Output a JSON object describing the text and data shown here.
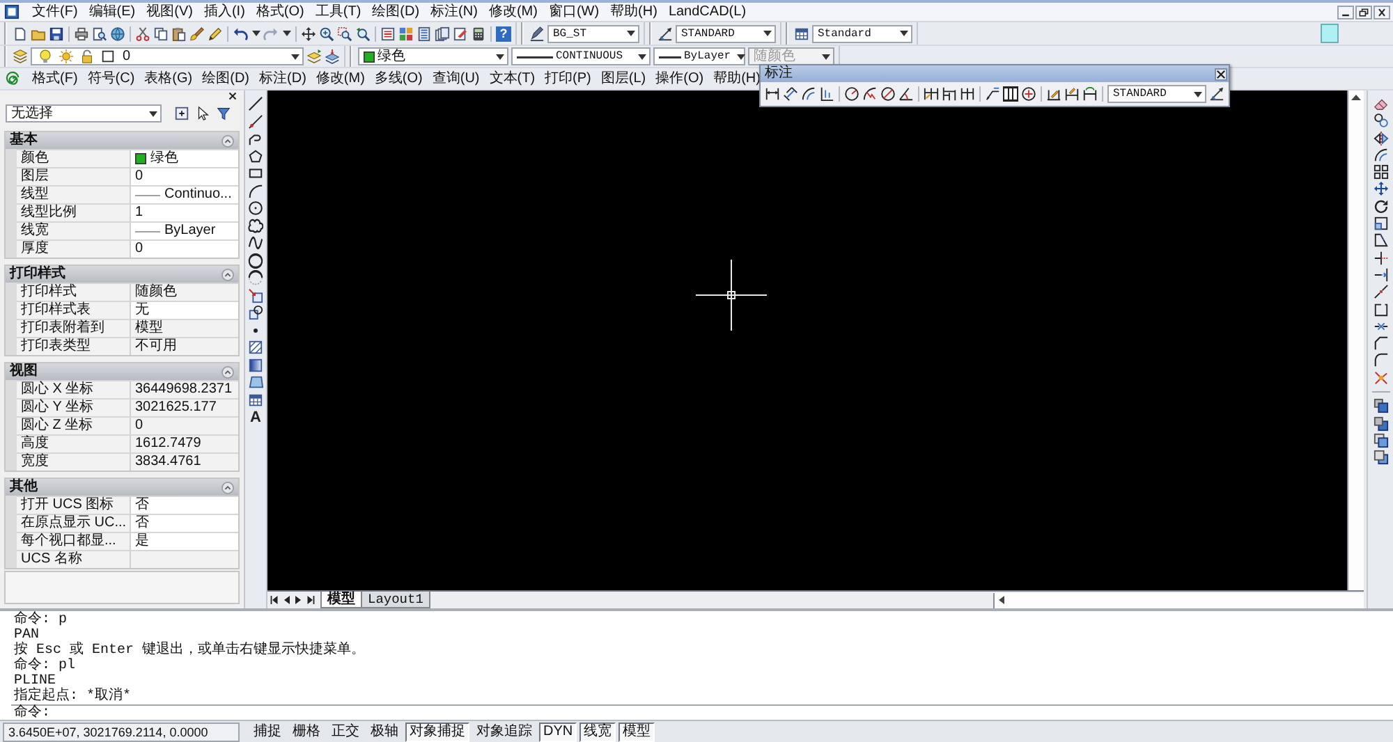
{
  "menu_bar": {
    "items": [
      "文件(F)",
      "编辑(E)",
      "视图(V)",
      "插入(I)",
      "格式(O)",
      "工具(T)",
      "绘图(D)",
      "标注(N)",
      "修改(M)",
      "窗口(W)",
      "帮助(H)",
      "LandCAD(L)"
    ]
  },
  "standard_toolbar": {
    "help_glyph": "?",
    "text_style": "BG_ST",
    "dimension_style": "STANDARD",
    "table_style": "Standard"
  },
  "layers_toolbar": {
    "layer": "0",
    "color": {
      "label": "绿色",
      "color": "#22b022"
    },
    "linetype": "CONTINUOUS",
    "lineweight": "ByLayer",
    "plot_style": {
      "value": "随颜色",
      "disabled": true
    }
  },
  "landcad_toolbar": {
    "items": [
      "格式(F)",
      "符号(C)",
      "表格(G)",
      "绘图(D)",
      "标注(D)",
      "修改(M)",
      "多线(O)",
      "查询(U)",
      "文本(T)",
      "打印(P)",
      "图层(L)",
      "操作(O)",
      "帮助(H)"
    ]
  },
  "properties_panel": {
    "selection": "无选择",
    "sections": [
      {
        "title": "基本",
        "expanded": true,
        "rows": [
          {
            "label": "颜色",
            "value": "绿色",
            "kind": "color",
            "color": "#22b022",
            "editable": true
          },
          {
            "label": "图层",
            "value": "0",
            "kind": "text",
            "editable": true
          },
          {
            "label": "线型",
            "value": "Continuo...",
            "kind": "line",
            "editable": true
          },
          {
            "label": "线型比例",
            "value": "1",
            "kind": "text",
            "editable": true
          },
          {
            "label": "线宽",
            "value": "ByLayer",
            "kind": "line",
            "editable": true
          },
          {
            "label": "厚度",
            "value": "0",
            "kind": "text",
            "editable": true
          }
        ]
      },
      {
        "title": "打印样式",
        "expanded": true,
        "rows": [
          {
            "label": "打印样式",
            "value": "随颜色",
            "kind": "text",
            "editable": false
          },
          {
            "label": "打印样式表",
            "value": "无",
            "kind": "text",
            "editable": true
          },
          {
            "label": "打印表附着到",
            "value": "模型",
            "kind": "text",
            "editable": false
          },
          {
            "label": "打印表类型",
            "value": "不可用",
            "kind": "text",
            "editable": false
          }
        ]
      },
      {
        "title": "视图",
        "expanded": true,
        "rows": [
          {
            "label": "圆心 X 坐标",
            "value": "36449698.2371",
            "kind": "text",
            "editable": false
          },
          {
            "label": "圆心 Y 坐标",
            "value": "3021625.177",
            "kind": "text",
            "editable": false
          },
          {
            "label": "圆心 Z 坐标",
            "value": "0",
            "kind": "text",
            "editable": false
          },
          {
            "label": "高度",
            "value": "1612.7479",
            "kind": "text",
            "editable": false
          },
          {
            "label": "宽度",
            "value": "3834.4761",
            "kind": "text",
            "editable": false
          }
        ]
      },
      {
        "title": "其他",
        "expanded": true,
        "rows": [
          {
            "label": "打开 UCS 图标",
            "value": "否",
            "kind": "text",
            "editable": true
          },
          {
            "label": "在原点显示 UC...",
            "value": "否",
            "kind": "text",
            "editable": true
          },
          {
            "label": "每个视口都显...",
            "value": "是",
            "kind": "text",
            "editable": true
          },
          {
            "label": "UCS 名称",
            "kind": "text",
            "editable": false
          }
        ]
      }
    ]
  },
  "dimension_toolbar": {
    "title": "标注",
    "dimension_style": "STANDARD"
  },
  "drawing_area": {
    "text_tool_glyph": "A",
    "layout_tabs": [
      {
        "label": "模型",
        "selected": true
      },
      {
        "label": "Layout1",
        "selected": false
      }
    ]
  },
  "command_line": {
    "history": [
      "命令: p",
      "PAN",
      "按 Esc 或 Enter 键退出，或单击右键显示快捷菜单。",
      "命令: pl",
      "PLINE",
      "指定起点: *取消*"
    ],
    "prompt": "命令:"
  },
  "status_bar": {
    "coordinates": "3.6450E+07, 3021769.2114, 0.0000",
    "toggles": [
      {
        "label": "捕捉",
        "on": false
      },
      {
        "label": "栅格",
        "on": false
      },
      {
        "label": "正交",
        "on": false
      },
      {
        "label": "极轴",
        "on": false
      },
      {
        "label": "对象捕捉",
        "on": true
      },
      {
        "label": "对象追踪",
        "on": false
      },
      {
        "label": "DYN",
        "on": true
      },
      {
        "label": "线宽",
        "on": true
      },
      {
        "label": "模型",
        "on": true
      }
    ]
  }
}
